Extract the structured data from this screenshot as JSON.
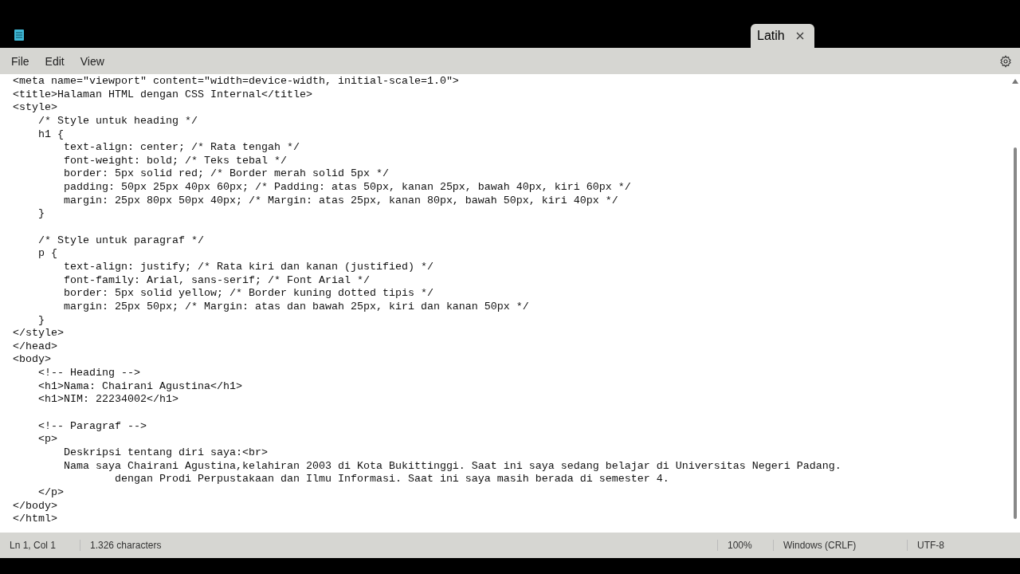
{
  "tab": {
    "title": "Latih",
    "selected": true
  },
  "menu": [
    "File",
    "Edit",
    "View"
  ],
  "lines": [
    {
      "kind": "code",
      "text": "<meta name=\"viewport\" content=\"width=device-width, initial-scale=1.0\">"
    },
    {
      "kind": "code",
      "text": "<title>Halaman HTML dengan CSS Internal</title>"
    },
    {
      "kind": "code",
      "text": "<style>"
    },
    {
      "kind": "code",
      "text": "    /* Style untuk heading */"
    },
    {
      "kind": "code",
      "text": "    h1 {"
    },
    {
      "kind": "code",
      "text": "        text-align: center; /* Rata tengah */"
    },
    {
      "kind": "code",
      "text": "        font-weight: bold; /* Teks tebal */"
    },
    {
      "kind": "code",
      "text": "        border: 5px solid red; /* Border merah solid 5px */"
    },
    {
      "kind": "code",
      "text": "        padding: 50px 25px 40px 60px; /* Padding: atas 50px, kanan 25px, bawah 40px, kiri 60px */"
    },
    {
      "kind": "code",
      "text": "        margin: 25px 80px 50px 40px; /* Margin: atas 25px, kanan 80px, bawah 50px, kiri 40px */"
    },
    {
      "kind": "code",
      "text": "    }"
    },
    {
      "kind": "blank"
    },
    {
      "kind": "code",
      "text": "    /* Style untuk paragraf */"
    },
    {
      "kind": "code",
      "text": "    p {"
    },
    {
      "kind": "code",
      "text": "        text-align: justify; /* Rata kiri dan kanan (justified) */"
    },
    {
      "kind": "code",
      "text": "        font-family: Arial, sans-serif; /* Font Arial */"
    },
    {
      "kind": "code",
      "text": "        border: 5px solid yellow; /* Border kuning dotted tipis */"
    },
    {
      "kind": "code",
      "text": "        margin: 25px 50px; /* Margin: atas dan bawah 25px, kiri dan kanan 50px */"
    },
    {
      "kind": "code",
      "text": "    }"
    },
    {
      "kind": "code",
      "text": "</style>"
    },
    {
      "kind": "code",
      "text": "</head>"
    },
    {
      "kind": "code",
      "text": "<body>"
    },
    {
      "kind": "code",
      "text": "    <!-- Heading -->"
    },
    {
      "kind": "code",
      "text": "    <h1>Nama: Chairani Agustina</h1>"
    },
    {
      "kind": "code",
      "text": "    <h1>NIM: 22234002</h1>"
    },
    {
      "kind": "blank"
    },
    {
      "kind": "code",
      "text": "    <!-- Paragraf -->"
    },
    {
      "kind": "code",
      "text": "    <p>"
    },
    {
      "kind": "code",
      "text": "        Deskripsi tentang diri saya:<br>"
    },
    {
      "kind": "code",
      "text": "        Nama saya Chairani Agustina,kelahiran 2003 di Kota Bukittinggi. Saat ini saya sedang belajar di Universitas Negeri Padang."
    },
    {
      "kind": "code",
      "text": "                dengan Prodi Perpustakaan dan Ilmu Informasi. Saat ini saya masih berada di semester 4."
    },
    {
      "kind": "code",
      "text": "    </p>"
    },
    {
      "kind": "code",
      "text": "</body>"
    },
    {
      "kind": "code",
      "text": "</html>"
    }
  ],
  "status": {
    "position": "Ln 1, Col 1",
    "characters": "1.326 characters",
    "zoom": "100%",
    "line_ending": "Windows (CRLF)",
    "encoding": "UTF-8"
  }
}
